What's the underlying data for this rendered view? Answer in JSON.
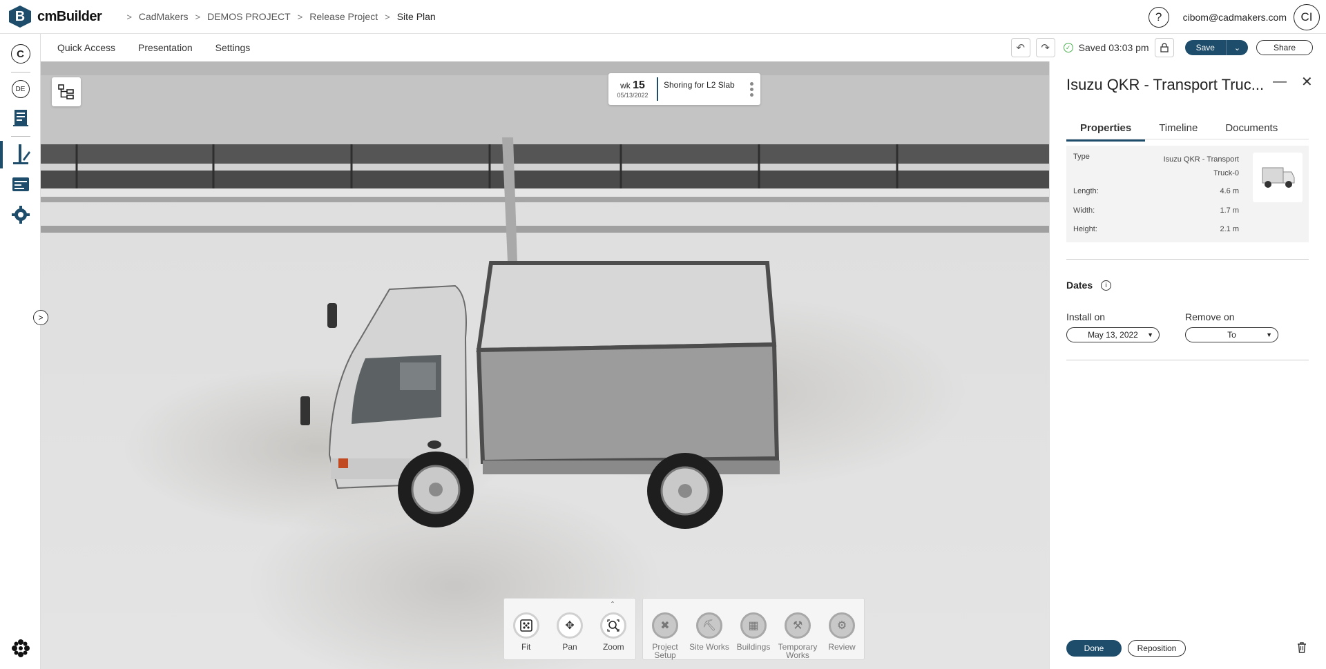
{
  "app": {
    "logo_letter": "B",
    "logo_text": "cmBuilder"
  },
  "breadcrumb": [
    {
      "label": "CadMakers"
    },
    {
      "label": "DEMOS PROJECT"
    },
    {
      "label": "Release Project"
    },
    {
      "label": "Site Plan"
    }
  ],
  "user": {
    "help": "?",
    "email": "cibom@cadmakers.com",
    "initials": "CI"
  },
  "rail": {
    "top_badge": "C",
    "lang": "DE"
  },
  "menu": {
    "quick_access": "Quick Access",
    "presentation": "Presentation",
    "settings": "Settings"
  },
  "status": {
    "saved": "Saved 03:03 pm",
    "save_label": "Save",
    "share_label": "Share"
  },
  "week_card": {
    "wk_label": "wk",
    "wk_number": "15",
    "date": "05/13/2022",
    "task": "Shoring for L2 Slab"
  },
  "dock": {
    "view_tools": [
      {
        "label": "Fit",
        "icon": "fit-icon"
      },
      {
        "label": "Pan",
        "icon": "pan-icon"
      },
      {
        "label": "Zoom",
        "icon": "zoom-icon"
      }
    ],
    "phase_tools": [
      {
        "label": "Project Setup",
        "icon": "project-setup-icon"
      },
      {
        "label": "Site Works",
        "icon": "site-works-icon"
      },
      {
        "label": "Buildings",
        "icon": "buildings-icon"
      },
      {
        "label": "Temporary Works",
        "icon": "temporary-works-icon"
      },
      {
        "label": "Review",
        "icon": "review-icon"
      }
    ]
  },
  "panel": {
    "title": "Isuzu QKR - Transport Truc...",
    "tabs": {
      "properties": "Properties",
      "timeline": "Timeline",
      "documents": "Documents"
    },
    "properties": {
      "type_label": "Type",
      "type_value": "Isuzu QKR - Transport Truck-0",
      "length_label": "Length:",
      "length_value": "4.6 m",
      "width_label": "Width:",
      "width_value": "1.7 m",
      "height_label": "Height:",
      "height_value": "2.1 m"
    },
    "dates": {
      "heading": "Dates",
      "install_label": "Install on",
      "install_value": "May 13, 2022",
      "remove_label": "Remove on",
      "remove_value": "To"
    },
    "done_label": "Done",
    "reposition_label": "Reposition"
  },
  "colors": {
    "brand": "#1d4d6b",
    "saved_green": "#4caf50"
  }
}
